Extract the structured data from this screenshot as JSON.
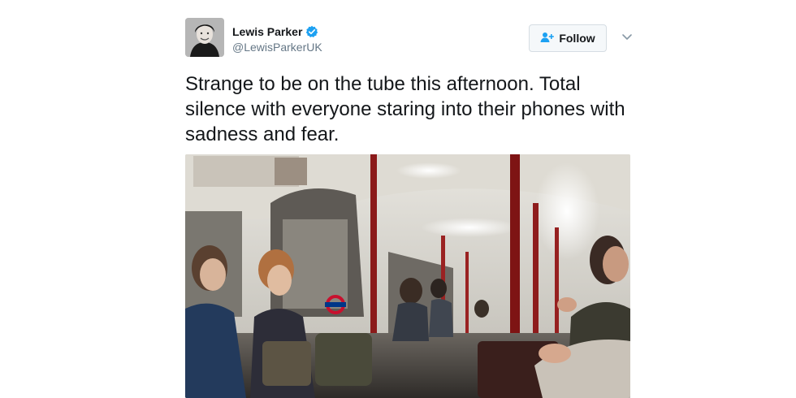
{
  "user": {
    "name": "Lewis Parker",
    "handle": "@LewisParkerUK",
    "verified": true
  },
  "actions": {
    "follow_label": "Follow"
  },
  "tweet": {
    "text": "Strange to be on the tube this afternoon. Total silence with everyone staring into their phones with sadness and fear."
  },
  "colors": {
    "verified": "#1da1f2",
    "follow_icon": "#1da1f2",
    "text": "#14171a",
    "muted": "#657786"
  },
  "icons": {
    "verified": "verified-badge-icon",
    "follow": "add-user-icon",
    "menu": "chevron-down-icon"
  }
}
